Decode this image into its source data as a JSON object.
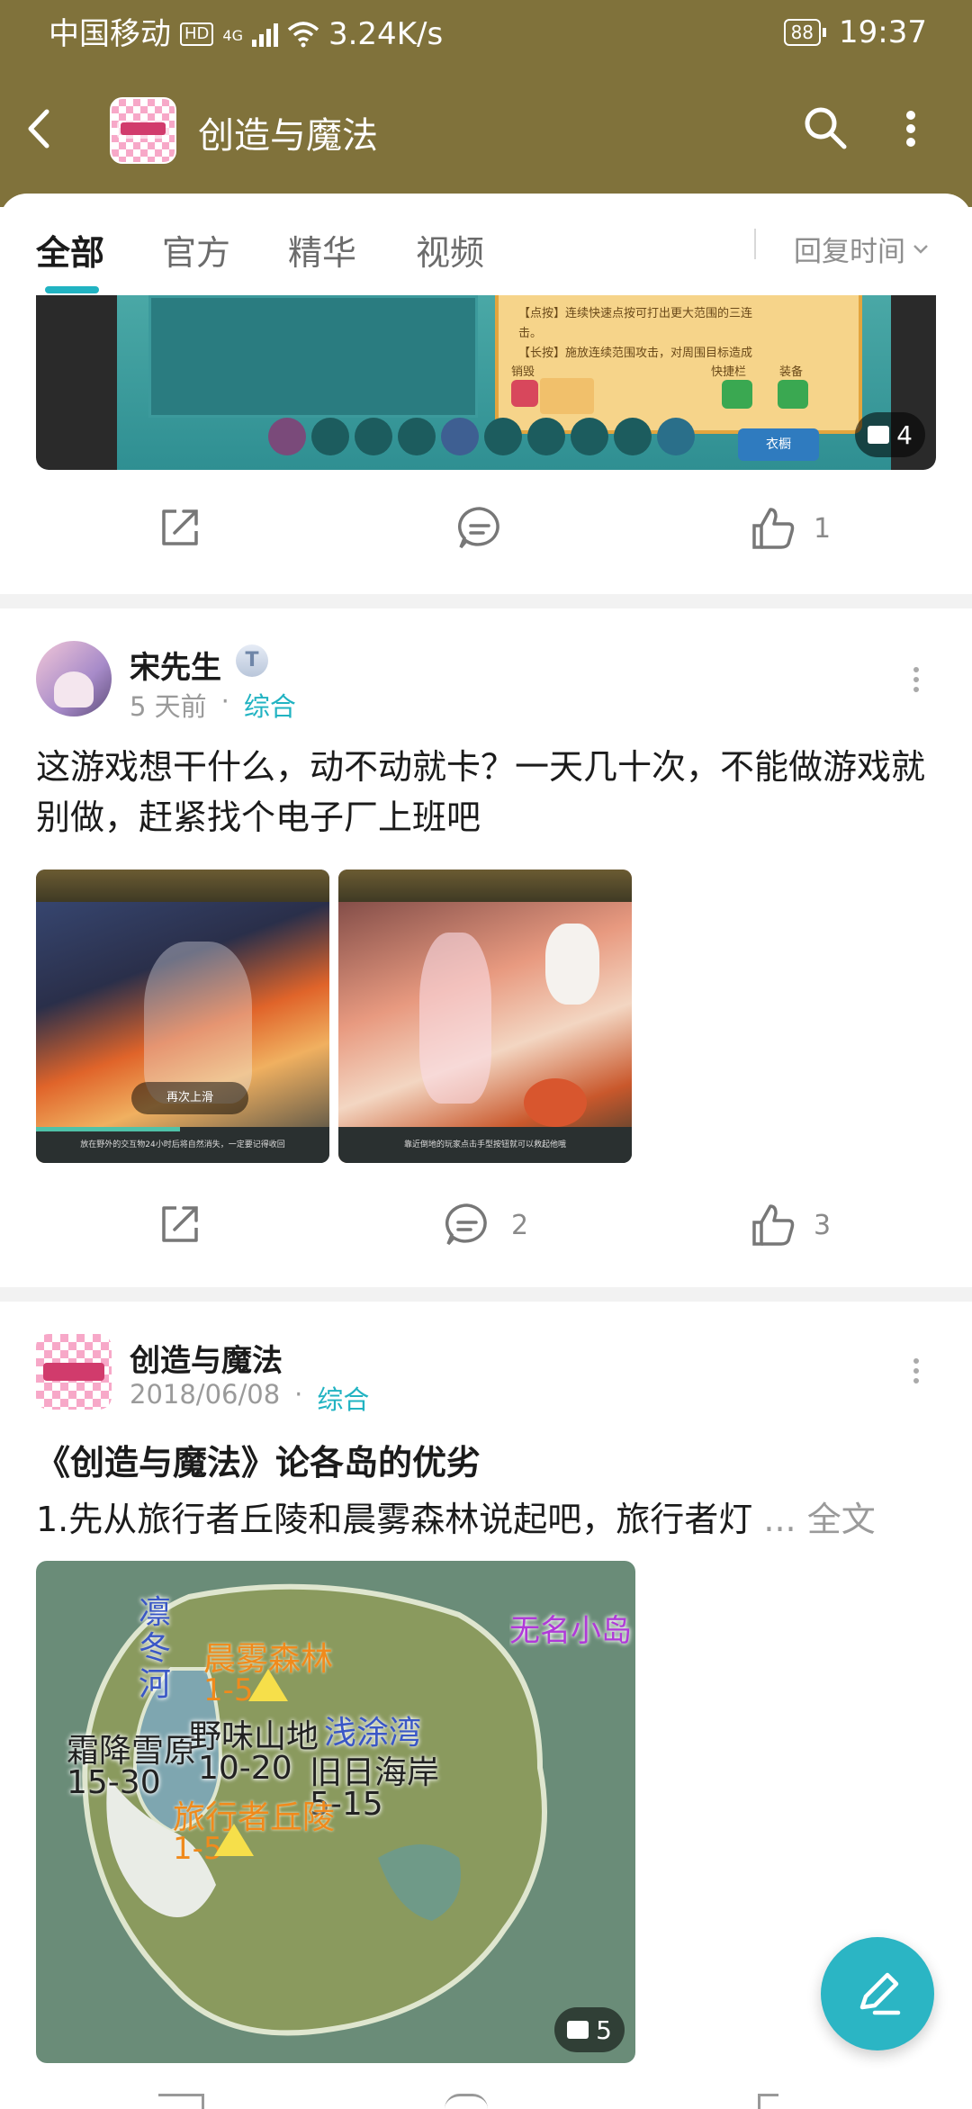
{
  "status_bar": {
    "carrier": "中国移动",
    "hd": "HD",
    "network": "4G",
    "speed": "3.24K/s",
    "battery": "88",
    "time": "19:37"
  },
  "header": {
    "title": "创造与魔法",
    "icons": [
      "back-arrow-icon",
      "search-icon",
      "more-vertical-icon"
    ]
  },
  "tabs": {
    "items": [
      {
        "label": "全部",
        "active": true
      },
      {
        "label": "官方",
        "active": false
      },
      {
        "label": "精华",
        "active": false
      },
      {
        "label": "视频",
        "active": false
      }
    ],
    "sort_label": "回复时间"
  },
  "post1": {
    "image_count": "4",
    "image_text_lines": [
      "【点按】连续快速点按可打出更大范围的三连",
      "击。",
      "【长按】施放连续范围攻击，对周围目标造成"
    ],
    "label_destroy": "销毁",
    "label_quickbar": "快捷栏",
    "label_equip": "装备",
    "label_wardrobe": "衣橱",
    "comments": "",
    "likes": "1"
  },
  "post2": {
    "author": "宋先生",
    "level_badge": "T",
    "time": "5 天前",
    "category": "综合",
    "text": "这游戏想干什么，动不动就卡？一天几十次，不能做游戏就别做，赶紧找个电子厂上班吧",
    "image1_overlay": "再次上滑",
    "image1_caption": "放在野外的交互物24小时后将自然消失，一定要记得收回",
    "image2_caption": "靠近倒地的玩家点击手型按钮就可以救起他哦",
    "comments": "2",
    "likes": "3"
  },
  "post3": {
    "author": "创造与魔法",
    "time": "2018/06/08",
    "category": "综合",
    "title": "《创造与魔法》论各岛的优劣",
    "excerpt": "1.先从旅行者丘陵和晨雾森林说起吧，旅行者灯",
    "ellipsis": "...",
    "full_text": "全文",
    "image_count": "5",
    "map_labels": {
      "river": "凛冬河",
      "forest": "晨雾森林",
      "forest_lv": "1-5",
      "unnamed": "无名小岛",
      "snow": "霜降雪原",
      "snow_lv": "15-30",
      "wild": "野味山地",
      "wild_lv": "10-20",
      "bay": "浅涂湾",
      "coast": "旧日海岸",
      "coast_lv": "5-15",
      "hills": "旅行者丘陵",
      "hills_lv": "1-5"
    }
  },
  "colors": {
    "header_bg": "#80723b",
    "accent_teal": "#21b3c2",
    "fab": "#2bb5c4"
  }
}
